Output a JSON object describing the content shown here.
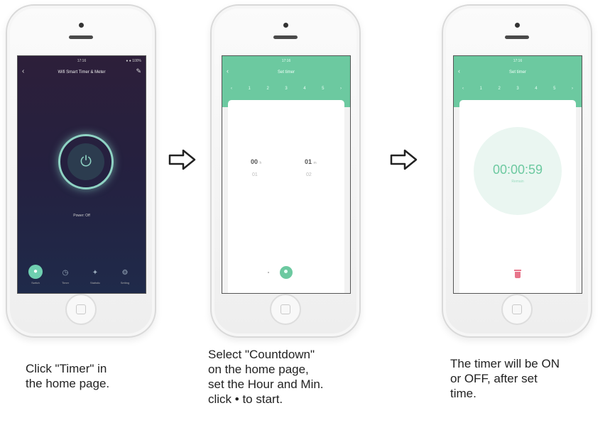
{
  "phone1": {
    "status_time": "17:16",
    "status_right": "● ● 100%",
    "back_icon": "‹",
    "title": "Wifi Smart Timer & Meter",
    "edit_icon": "✎",
    "power_icon": "⏻",
    "state_text": "Power: Off",
    "nav": [
      {
        "icon": "●",
        "label": "Switch"
      },
      {
        "icon": "◷",
        "label": "Timer"
      },
      {
        "icon": "✦",
        "label": "Statistic"
      },
      {
        "icon": "⚙",
        "label": "Setting"
      }
    ]
  },
  "phone2": {
    "status": "17:16",
    "title": "Set timer",
    "tabs": [
      "‹",
      "1",
      "2",
      "3",
      "4",
      "5",
      "›"
    ],
    "hour_value": "00",
    "hour_unit": "h",
    "hour_next": "01",
    "min_value": "01",
    "min_unit": "m",
    "min_next": "02"
  },
  "phone3": {
    "status": "17:16",
    "title": "Set timer",
    "tabs": [
      "‹",
      "1",
      "2",
      "3",
      "4",
      "5",
      "›"
    ],
    "countdown": "00:00:59",
    "countdown_caption": "Remain"
  },
  "captions": {
    "c1": [
      "Click \"Timer\" in",
      "the home page."
    ],
    "c2": [
      "Select \"Countdown\"",
      "on the home page,",
      "set the Hour and Min.",
      "click • to start."
    ],
    "c3": [
      "The timer will be ON",
      "or OFF, after set",
      "time."
    ]
  },
  "colors": {
    "accent_green": "#6cc9a0",
    "screen1_bg": "#25203f",
    "delete_red": "#e8758b"
  }
}
